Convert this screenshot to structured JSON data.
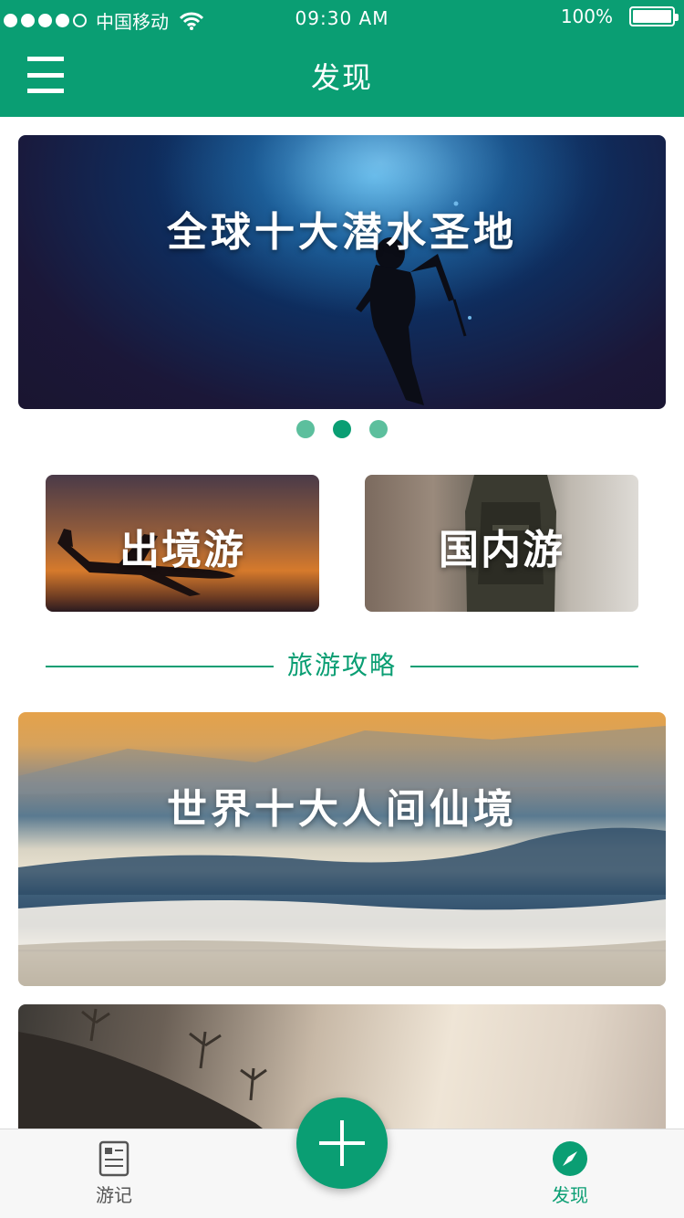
{
  "status_bar": {
    "carrier": "中国移动",
    "time": "09:30 AM",
    "battery": "100%",
    "signal_bars_filled": 4,
    "signal_bars_total": 5,
    "battery_level": 1.0
  },
  "nav": {
    "title": "发现",
    "menu_icon": "hamburger-menu-icon"
  },
  "banner": {
    "title": "全球十大潜水圣地",
    "page_count": 3,
    "active_page": 2
  },
  "categories": [
    {
      "label": "出境游"
    },
    {
      "label": "国内游"
    }
  ],
  "section": {
    "title": "旅游攻略"
  },
  "articles": [
    {
      "title": "世界十大人间仙境"
    },
    {
      "title": ""
    }
  ],
  "tab_bar": {
    "items": [
      {
        "label": "游记",
        "icon": "notes-icon",
        "active": false
      },
      {
        "label": "发现",
        "icon": "compass-icon",
        "active": true
      }
    ],
    "fab_icon": "plus-icon"
  },
  "colors": {
    "brand": "#0a9e73",
    "pager_inactive": "#5cbf9d",
    "tab_inactive": "#555555"
  }
}
